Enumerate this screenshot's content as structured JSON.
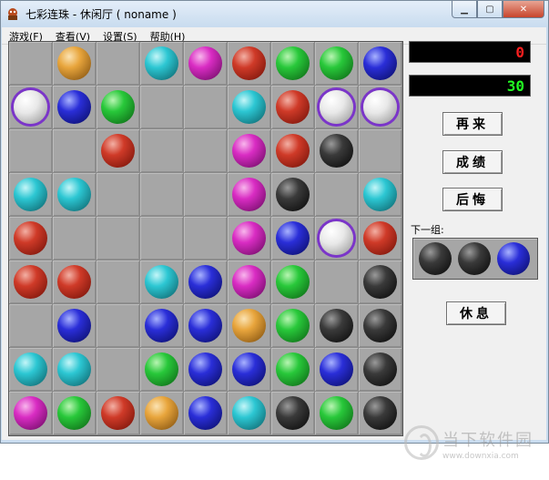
{
  "window": {
    "title": "七彩连珠 - 休闲厅 ( noname )"
  },
  "menu": [
    {
      "label": "游戏(F)"
    },
    {
      "label": "查看(V)"
    },
    {
      "label": "设置(S)"
    },
    {
      "label": "帮助(H)"
    }
  ],
  "board": {
    "rows": [
      [
        "",
        "orange",
        "",
        "cyan",
        "magenta",
        "red",
        "green",
        "green",
        "blue"
      ],
      [
        "white*",
        "blue",
        "green",
        "",
        "",
        "cyan",
        "red",
        "white*",
        "white*"
      ],
      [
        "",
        "",
        "red",
        "",
        "",
        "magenta",
        "red",
        "black",
        ""
      ],
      [
        "cyan",
        "cyan",
        "",
        "",
        "",
        "magenta",
        "black",
        "",
        "cyan"
      ],
      [
        "red",
        "",
        "",
        "",
        "",
        "magenta",
        "blue",
        "white*",
        "red"
      ],
      [
        "red",
        "red",
        "",
        "cyan",
        "blue",
        "magenta",
        "green",
        "",
        "black"
      ],
      [
        "",
        "blue",
        "",
        "blue",
        "blue",
        "orange",
        "green",
        "black",
        "black"
      ],
      [
        "cyan",
        "cyan",
        "",
        "green",
        "blue",
        "blue",
        "green",
        "blue",
        "black"
      ],
      [
        "magenta",
        "green",
        "red",
        "orange",
        "blue",
        "cyan",
        "black",
        "green",
        "black"
      ]
    ]
  },
  "scores": {
    "current": "0",
    "high": "30"
  },
  "buttons": {
    "restart": "再来",
    "scores": "成绩",
    "undo": "后悔",
    "rest": "休息"
  },
  "next": {
    "label": "下一组:",
    "balls": [
      "black",
      "black",
      "blue"
    ]
  },
  "watermark": {
    "text": "当下软件园",
    "url": "www.downxia.com"
  }
}
